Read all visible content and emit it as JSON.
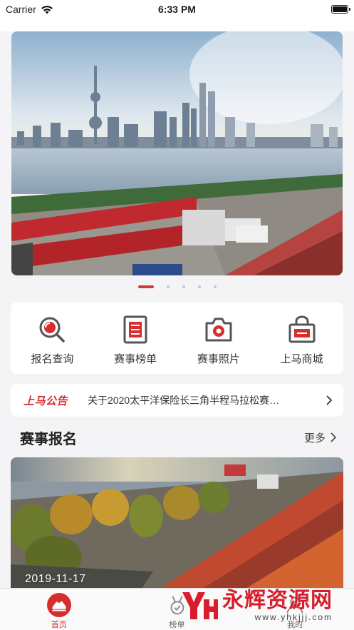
{
  "status_bar": {
    "carrier": "Carrier",
    "time": "6:33 PM"
  },
  "banner": {
    "dots_count": 5,
    "active_index": 0
  },
  "quick_actions": [
    {
      "label": "报名查询",
      "icon": "search-icon"
    },
    {
      "label": "赛事榜单",
      "icon": "ranking-list-icon"
    },
    {
      "label": "赛事照片",
      "icon": "camera-icon"
    },
    {
      "label": "上马商城",
      "icon": "shop-basket-icon"
    }
  ],
  "notice": {
    "logo": "上马公告",
    "text": "关于2020太平洋保险长三角半程马拉松赛…"
  },
  "section": {
    "title": "赛事报名",
    "more": "更多"
  },
  "event": {
    "date": "2019-11-17"
  },
  "tabbar": [
    {
      "label": "首页",
      "icon": "running-shoe-icon",
      "active": true
    },
    {
      "label": "榜单",
      "icon": "medal-icon",
      "active": false
    },
    {
      "label": "我的",
      "icon": "profile-icon",
      "active": false
    }
  ],
  "watermark": {
    "title": "永辉资源网",
    "url": "www.yhkjjj.com"
  },
  "colors": {
    "accent": "#d62d2d",
    "background": "#f4f4f6"
  }
}
